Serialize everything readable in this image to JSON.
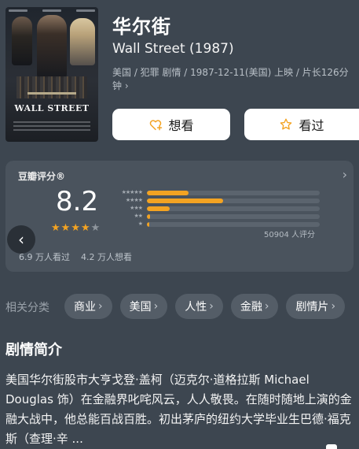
{
  "movie": {
    "title": "华尔街",
    "original_title": "Wall Street (1987)",
    "meta": "美国 / 犯罪 剧情 / 1987-12-11(美国) 上映 / 片长126分钟 ›",
    "poster_title": "WALL STREET"
  },
  "actions": {
    "want_label": "想看",
    "seen_label": "看过"
  },
  "rating": {
    "title": "豆瓣评分®",
    "score": "8.2",
    "stars": 4,
    "distribution": [
      {
        "stars": "★★★★★",
        "fraction": 0.24
      },
      {
        "stars": "★★★★",
        "fraction": 0.44
      },
      {
        "stars": "★★★",
        "fraction": 0.13
      },
      {
        "stars": "★★",
        "fraction": 0.02
      },
      {
        "stars": "★",
        "fraction": 0.015
      }
    ],
    "count": "50904 人评分",
    "watched": "6.9 万人看过",
    "wanted": "4.2 万人想看"
  },
  "related": {
    "label": "相关分类",
    "chips": [
      "商业",
      "美国",
      "人性",
      "金融",
      "剧情片"
    ]
  },
  "synopsis": {
    "title": "剧情简介",
    "text": "美国华尔街股市大亨戈登·盖柯（迈克尔·道格拉斯 Michael Douglas 饰）在金融界叱咤风云，人人敬畏。在随时随地上演的金融大战中，他总能百战百胜。初出茅庐的纽约大学毕业生巴德·福克斯（查理·辛 ..."
  },
  "colors": {
    "background": "#3d4650",
    "card": "#4a535d",
    "accent": "#f3a322"
  },
  "icons": {
    "want": "heart-plus-icon",
    "seen": "star-outline-icon",
    "back": "chevron-left-icon",
    "more": "chevron-right-icon"
  }
}
